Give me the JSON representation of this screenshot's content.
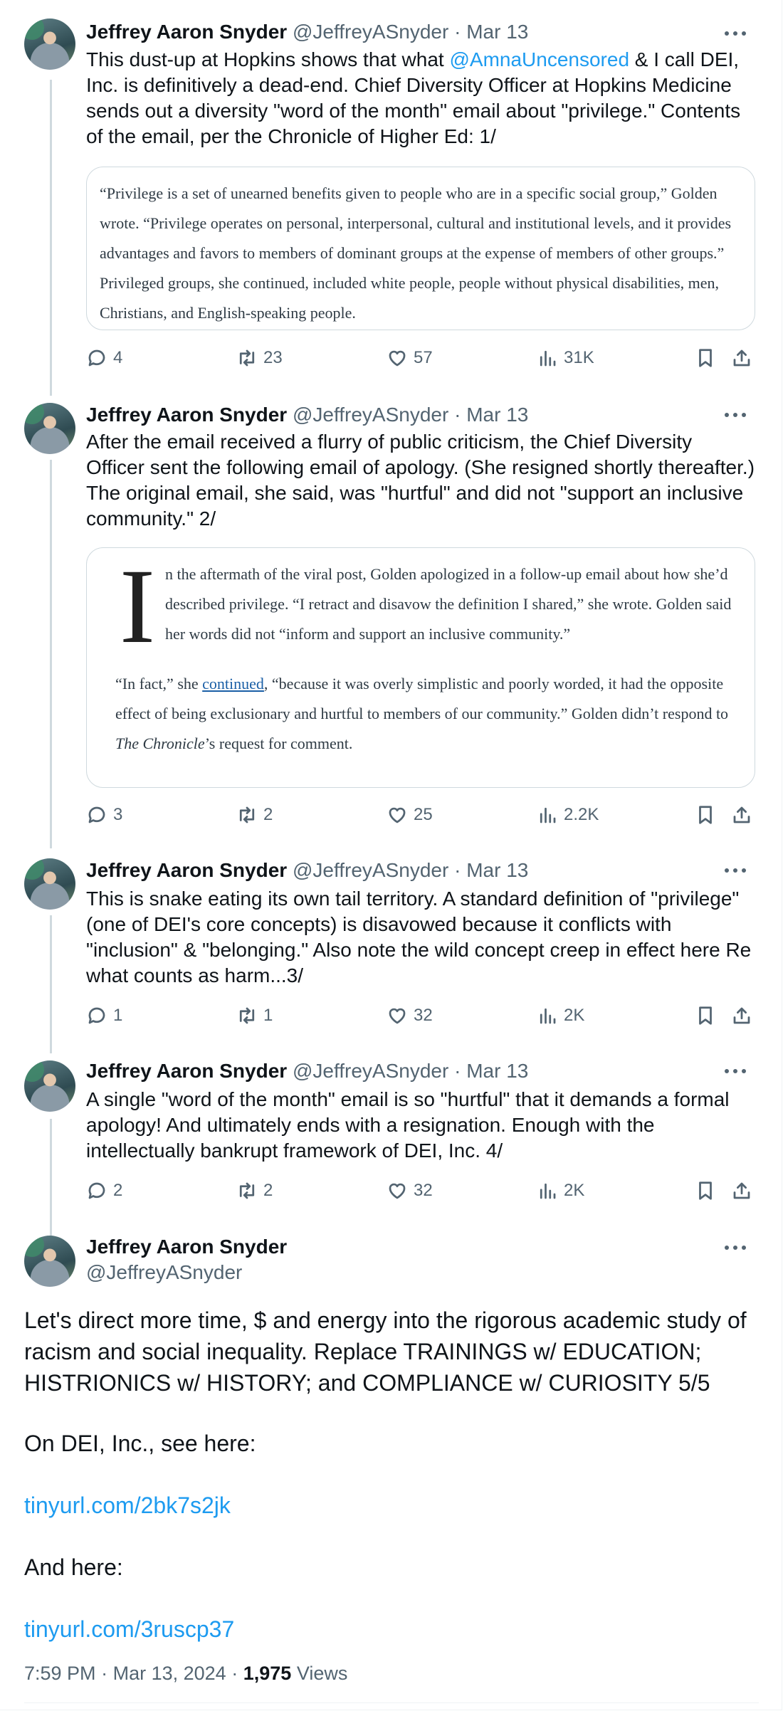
{
  "author": {
    "name": "Jeffrey Aaron Snyder",
    "handle": "@JeffreyASnyder",
    "separator": "·"
  },
  "tweets": [
    {
      "date": "Mar 13",
      "text_before_mention": "This dust-up at Hopkins shows that what ",
      "mention": "@AmnaUncensored",
      "text_after_mention": " & I call DEI, Inc. is definitively a dead-end. Chief Diversity Officer at Hopkins Medicine sends out a diversity \"word of the month\" email about \"privilege.\" Contents of the email, per the Chronicle of Higher Ed: 1/",
      "quote": "“Privilege is a set of unearned benefits given to people who are in a specific social group,” Golden wrote. “Privilege operates on personal, interpersonal, cultural and institutional levels, and it provides advantages and favors to members of dominant groups at the expense of members of other groups.” Privileged groups, she continued, included white people, people without physical disabilities, men, Christians, and English-speaking people.",
      "replies": "4",
      "retweets": "23",
      "likes": "57",
      "views": "31K"
    },
    {
      "date": "Mar 13",
      "text": "After the email received a flurry of public criticism, the Chief Diversity Officer sent the following email of apology. (She resigned shortly thereafter.) The original email, she said, was \"hurtful\" and did not \"support an inclusive community.\" 2/",
      "quote_dropcap": "I",
      "quote_p1": "n the aftermath of the viral post, Golden apologized in a follow-up email about how she’d described privilege. “I retract and disavow the definition I shared,” she wrote. Golden said her words did not “inform and support an inclusive community.”",
      "quote_p2_a": "“In fact,” she ",
      "quote_p2_link": "continued",
      "quote_p2_b": ", “because it was overly simplistic and poorly worded, it had the opposite effect of being exclusionary and hurtful to members of our community.” Golden didn’t respond to ",
      "quote_p2_italic": "The Chronicle",
      "quote_p2_c": "’s request for comment.",
      "replies": "3",
      "retweets": "2",
      "likes": "25",
      "views": "2.2K"
    },
    {
      "date": "Mar 13",
      "text": "This is snake eating its own tail territory. A standard definition of \"privilege\" (one of DEI's core concepts) is disavowed because it conflicts with \"inclusion\" & \"belonging.\" Also note the wild concept creep in effect here Re what counts as harm...3/",
      "replies": "1",
      "retweets": "1",
      "likes": "32",
      "views": "2K"
    },
    {
      "date": "Mar 13",
      "text": "A single \"word of the month\" email is so \"hurtful\" that it demands a formal apology! And ultimately ends with a resignation. Enough with the intellectually bankrupt framework of DEI, Inc. 4/",
      "replies": "2",
      "retweets": "2",
      "likes": "32",
      "views": "2K"
    }
  ],
  "main_tweet": {
    "p1": "Let's direct more time, $ and energy into the rigorous academic study of racism and social inequality. Replace TRAININGS w/ EDUCATION; HISTRIONICS w/ HISTORY; and COMPLIANCE w/ CURIOSITY 5/5",
    "p2": "On DEI, Inc., see here:",
    "link1": "tinyurl.com/2bk7s2jk",
    "p3": "And here:",
    "link2": "tinyurl.com/3ruscp37",
    "time": "7:59 PM",
    "date": "Mar 13, 2024",
    "views_count": "1,975",
    "views_label": "Views"
  },
  "colors": {
    "accent": "#1d9bf0",
    "muted": "#536471",
    "text": "#0f1419",
    "border": "#cfd9de"
  },
  "icons": [
    "reply-icon",
    "retweet-icon",
    "like-icon",
    "views-icon",
    "bookmark-icon",
    "share-icon",
    "more-icon"
  ]
}
